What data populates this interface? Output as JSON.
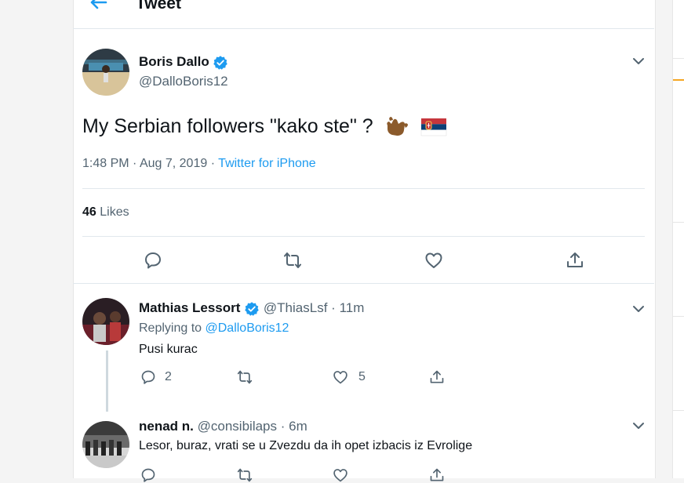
{
  "header": {
    "title": "Tweet",
    "back_icon": "arrow-left-icon"
  },
  "main_tweet": {
    "author_name": "Boris Dallo",
    "author_handle": "@DalloBoris12",
    "verified": true,
    "text": "My Serbian followers \"kako ste\" ?",
    "emojis": [
      "call-me-hand-emoji",
      "serbia-flag-emoji"
    ],
    "time": "1:48 PM",
    "date": "Aug 7, 2019",
    "source": "Twitter for iPhone",
    "likes_count": "46",
    "likes_label": "Likes",
    "actions": [
      "reply-icon",
      "retweet-icon",
      "like-icon",
      "share-icon"
    ]
  },
  "replies": [
    {
      "author_name": "Mathias Lessort",
      "author_handle": "@ThiasLsf",
      "verified": true,
      "time": "11m",
      "replying_to_label": "Replying to",
      "replying_to_handle": "@DalloBoris12",
      "text": "Pusi kurac",
      "reply_count": "2",
      "retweet_count": "",
      "like_count": "5"
    },
    {
      "author_name": "nenad n.",
      "author_handle": "@consibilaps",
      "verified": false,
      "time": "6m",
      "text": "Lesor, buraz, vrati se u Zvezdu da ih opet izbacis iz Evrolige"
    }
  ],
  "separator": "·",
  "colors": {
    "accent": "#1d9bf0",
    "text": "#0f1419",
    "muted": "#536471",
    "border": "#e1e8ed",
    "highlight": "#f5a623"
  }
}
